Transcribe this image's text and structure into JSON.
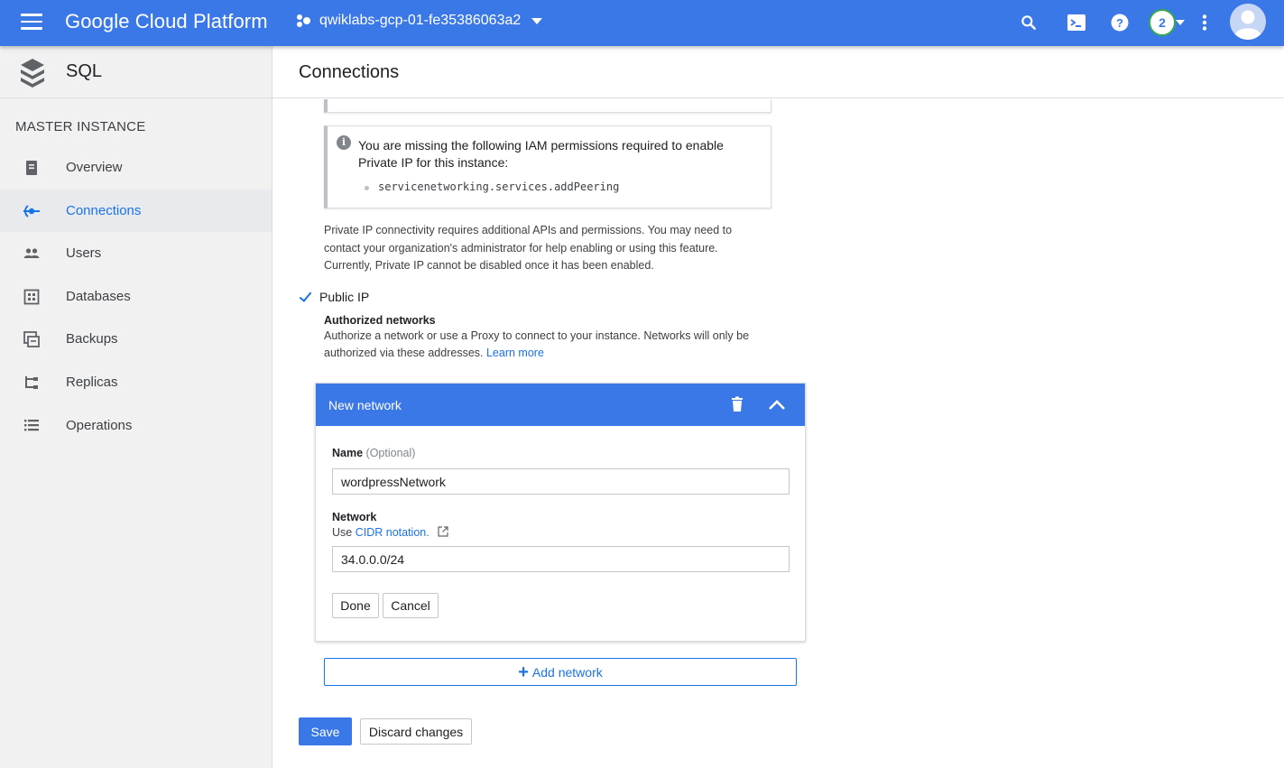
{
  "topbar": {
    "brand": "Google Cloud Platform",
    "project": "qwiklabs-gcp-01-fe35386063a2",
    "notification_count": "2",
    "accent_color": "#3b78e7",
    "icons": [
      "menu-icon",
      "project-icon",
      "search-icon",
      "cloud-shell-icon",
      "help-icon",
      "notifications-badge",
      "more-vert-icon",
      "account-avatar"
    ]
  },
  "sidebar": {
    "product": "SQL",
    "section": "MASTER INSTANCE",
    "items": [
      {
        "label": "Overview",
        "icon": "overview-icon",
        "active": false
      },
      {
        "label": "Connections",
        "icon": "connections-icon",
        "active": true
      },
      {
        "label": "Users",
        "icon": "users-icon",
        "active": false
      },
      {
        "label": "Databases",
        "icon": "databases-icon",
        "active": false
      },
      {
        "label": "Backups",
        "icon": "backups-icon",
        "active": false
      },
      {
        "label": "Replicas",
        "icon": "replicas-icon",
        "active": false
      },
      {
        "label": "Operations",
        "icon": "operations-icon",
        "active": false
      }
    ]
  },
  "main": {
    "title": "Connections",
    "warning": {
      "message": "You are missing the following IAM permissions required to enable Private IP for this instance:",
      "permission": "servicenetworking.services.addPeering"
    },
    "private_ip_note": "Private IP connectivity requires additional APIs and permissions. You may need to contact your organization's administrator for help enabling or using this feature. Currently, Private IP cannot be disabled once it has been enabled.",
    "public_ip": {
      "label": "Public IP",
      "checked": true
    },
    "authorized_networks": {
      "title": "Authorized networks",
      "description": "Authorize a network or use a Proxy to connect to your instance. Networks will only be authorized via these addresses.",
      "learn_more": "Learn more"
    },
    "new_network": {
      "title": "New network",
      "name_label": "Name",
      "name_optional": "(Optional)",
      "name_value": "wordpressNetwork",
      "network_label": "Network",
      "network_hint_prefix": "Use",
      "network_hint_link": "CIDR notation.",
      "network_value": "34.0.0.0/24",
      "done": "Done",
      "cancel": "Cancel"
    },
    "add_network": "Add network",
    "save": "Save",
    "discard": "Discard changes"
  }
}
